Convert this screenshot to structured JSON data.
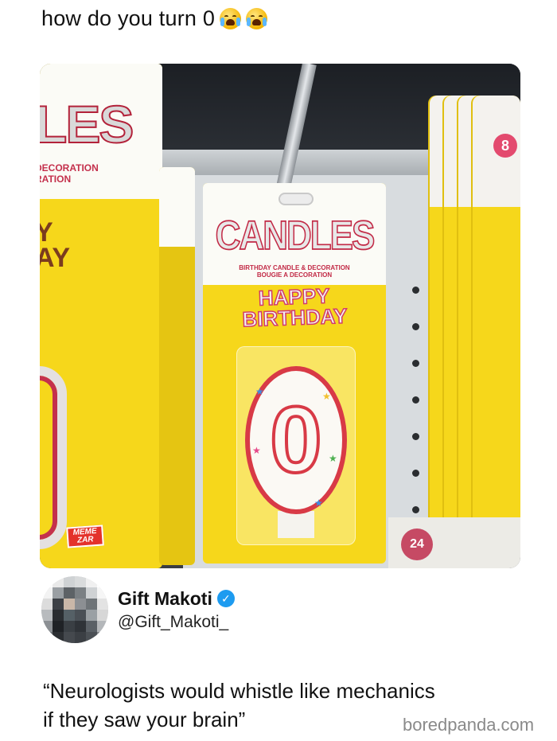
{
  "post": {
    "caption": "how do you turn 0",
    "emoji_1": "loudly-crying-face-icon",
    "emoji_2": "loudly-crying-face-icon"
  },
  "photo": {
    "left_package_brand": "LES",
    "left_package_lines": [
      "DECORATION",
      "RATION"
    ],
    "left_package_bday": [
      "Y",
      "AY"
    ],
    "main_package": {
      "brand": "CANDLES",
      "subtitle_1": "BIRTHDAY CANDLE & DECORATION",
      "subtitle_2": "BOUGIE A DECORATION",
      "line_1": "HAPPY",
      "line_2": "BIRTHDAY",
      "candle_number": "0"
    },
    "right_badge": "8",
    "bottom_badge": "24",
    "watermark": [
      "MEME",
      "ZAR"
    ]
  },
  "author": {
    "name": "Gift Makoti",
    "handle": "@Gift_Makoti_",
    "verified": true
  },
  "quote": {
    "line_1": "“Neurologists would whistle like mechanics",
    "line_2": "if they saw your brain”"
  },
  "source": "boredpanda.com",
  "colors": {
    "accent_red": "#d83a46",
    "package_yellow": "#f6d71b",
    "verified_blue": "#1d9bf0",
    "source_gray": "#8a8a8a"
  }
}
